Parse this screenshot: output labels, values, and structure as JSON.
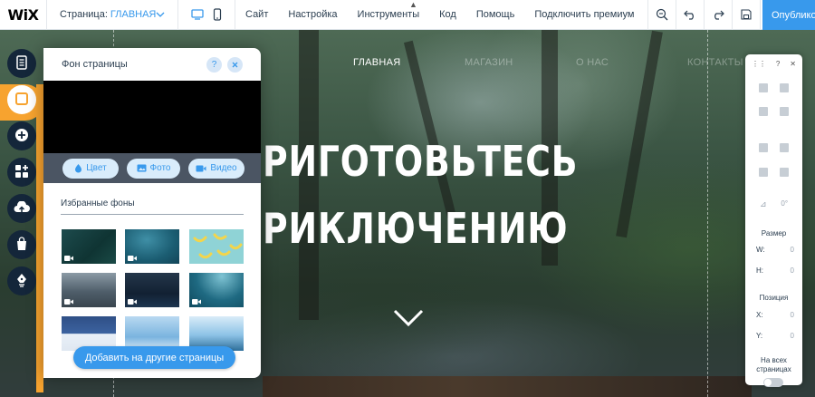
{
  "topbar": {
    "logo": "WiX",
    "page_label": "Страница:",
    "page_value": "ГЛАВНАЯ",
    "menu": [
      "Сайт",
      "Настройка",
      "Инструменты",
      "Код",
      "Помощь",
      "Подключить премиум"
    ],
    "publish_label": "Опубликовать",
    "icons": [
      "desktop-icon",
      "mobile-icon",
      "zoom-icon",
      "undo-icon",
      "redo-icon",
      "save-icon",
      "preview-icon"
    ]
  },
  "site": {
    "nav": [
      "ГЛАВНАЯ",
      "МАГАЗИН",
      "О НАС",
      "КОНТАКТЫ"
    ],
    "headline_line1": "РИГОТОВЬТЕСЬ",
    "headline_line2": "РИКЛЮЧЕНИЮ"
  },
  "rail": {
    "icons": [
      "menus-pages-icon",
      "background-icon",
      "add-icon",
      "apps-icon",
      "upload-icon",
      "store-icon",
      "blog-icon"
    ],
    "active_index": 1,
    "accent_color": "#f7a32f"
  },
  "panel": {
    "title": "Фон страницы",
    "help": "?",
    "buttons": {
      "color": "Цвет",
      "image": "Фото",
      "video": "Видео"
    },
    "section_title": "Избранные фоны",
    "thumbnails": [
      {
        "name": "dark-teal",
        "video": true
      },
      {
        "name": "ocean-surface",
        "video": true
      },
      {
        "name": "bananas",
        "video": false
      },
      {
        "name": "storm-clouds",
        "video": true
      },
      {
        "name": "night-water",
        "video": true
      },
      {
        "name": "underwater",
        "video": true
      },
      {
        "name": "stars-blue",
        "video": false
      },
      {
        "name": "sky-clouds",
        "video": false
      },
      {
        "name": "lake-reflection",
        "video": false
      }
    ],
    "add_button": "Добавить на другие страницы"
  },
  "inspector": {
    "help": "?",
    "size_label": "Размер",
    "w_label": "W:",
    "w_value": "0",
    "h_label": "H:",
    "h_value": "0",
    "position_label": "Позиция",
    "x_label": "X:",
    "x_value": "0",
    "y_label": "Y:",
    "y_value": "0",
    "rotate_value": "0°",
    "all_pages_label": "На всех страницах"
  }
}
